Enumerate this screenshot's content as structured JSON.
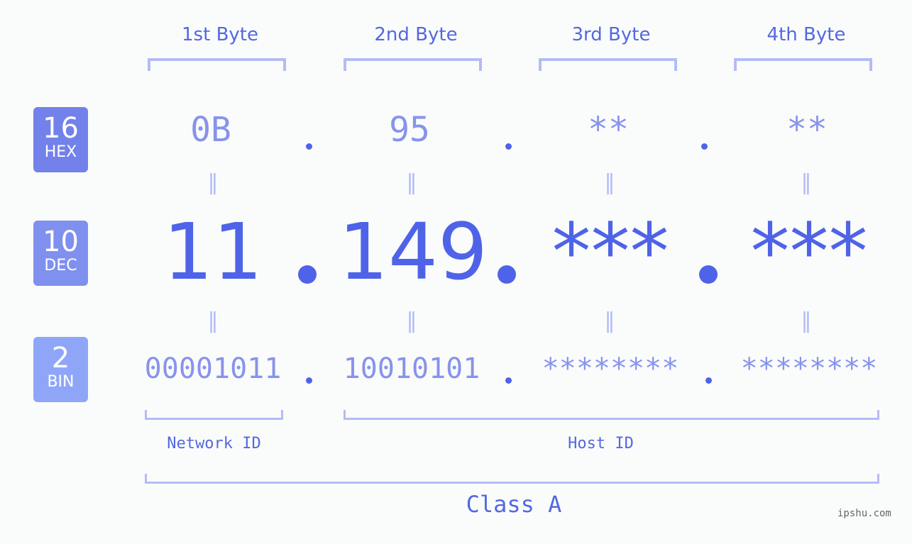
{
  "bytes": [
    {
      "header": "1st Byte",
      "hex": "0B",
      "dec": "11",
      "bin": "00001011"
    },
    {
      "header": "2nd Byte",
      "hex": "95",
      "dec": "149",
      "bin": "10010101"
    },
    {
      "header": "3rd Byte",
      "hex": "**",
      "dec": "***",
      "bin": "********"
    },
    {
      "header": "4th Byte",
      "hex": "**",
      "dec": "***",
      "bin": "********"
    }
  ],
  "bases": [
    {
      "num": "16",
      "label": "HEX",
      "color": "#7381ea"
    },
    {
      "num": "10",
      "label": "DEC",
      "color": "#8090ef"
    },
    {
      "num": "2",
      "label": "BIN",
      "color": "#8fa6f8"
    }
  ],
  "equals_sign": "=",
  "network_id_label": "Network ID",
  "host_id_label": "Host ID",
  "class_label": "Class A",
  "watermark": "ipshu.com"
}
